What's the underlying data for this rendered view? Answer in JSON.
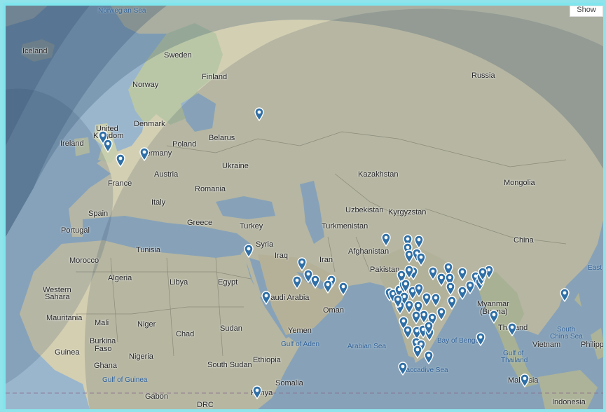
{
  "controls": {
    "show_button": "Show"
  },
  "colors": {
    "marker": "#2f6fa6",
    "overlay": "#2b4a6b"
  },
  "labels": {
    "norwegian_sea": "Norwegian Sea",
    "iceland": "Iceland",
    "sweden": "Sweden",
    "finland": "Finland",
    "norway": "Norway",
    "russia": "Russia",
    "denmark": "Denmark",
    "united_kingdom_1": "United",
    "united_kingdom_2": "Kingdom",
    "belarus": "Belarus",
    "ireland": "Ireland",
    "poland": "Poland",
    "germany": "Germany",
    "ukraine": "Ukraine",
    "kazakhstan": "Kazakhstan",
    "mongolia": "Mongolia",
    "france": "France",
    "austria": "Austria",
    "romania": "Romania",
    "italy": "Italy",
    "spain": "Spain",
    "uzbekistan": "Uzbekistan",
    "kyrgyzstan": "Kyrgyzstan",
    "portugal": "Portugal",
    "greece": "Greece",
    "turkey": "Turkey",
    "turkmenistan": "Turkmenistan",
    "china": "China",
    "syria": "Syria",
    "afghanistan": "Afghanistan",
    "tunisia": "Tunisia",
    "iraq": "Iraq",
    "iran": "Iran",
    "morocco": "Morocco",
    "pakistan": "Pakistan",
    "algeria": "Algeria",
    "libya": "Libya",
    "egypt": "Egypt",
    "western_sahara_1": "Western",
    "western_sahara_2": "Sahara",
    "saudi_arabia": "Saudi Arabia",
    "myanmar_1": "Myanmar",
    "myanmar_2": "(Burma)",
    "oman": "Oman",
    "mauritania": "Mauritania",
    "mali": "Mali",
    "niger": "Niger",
    "chad": "Chad",
    "sudan": "Sudan",
    "yemen": "Yemen",
    "thailand": "Thailand",
    "south_china_sea_1": "South",
    "south_china_sea_2": "China Sea",
    "burkina_faso_1": "Burkina",
    "burkina_faso_2": "Faso",
    "guinea": "Guinea",
    "gulf_of_aden": "Gulf of Aden",
    "arabian_sea": "Arabian Sea",
    "bay_of_bengal": "Bay of Bengal",
    "vietnam": "Vietnam",
    "philippines": "Philipp",
    "ghana": "Ghana",
    "nigeria": "Nigeria",
    "ethiopia": "Ethiopia",
    "gulf_of_thailand_1": "Gulf of",
    "gulf_of_thailand_2": "Thailand",
    "south_sudan": "South Sudan",
    "laccadive_sea": "Laccadive Sea",
    "gulf_of_guinea": "Gulf of Guinea",
    "somalia": "Somalia",
    "malaysia": "Malaysia",
    "gabon": "Gabon",
    "drc": "DRC",
    "kenya": "Kenya",
    "indonesia": "Indonesia",
    "east_china_sea": "East C"
  },
  "markers_count": 98
}
